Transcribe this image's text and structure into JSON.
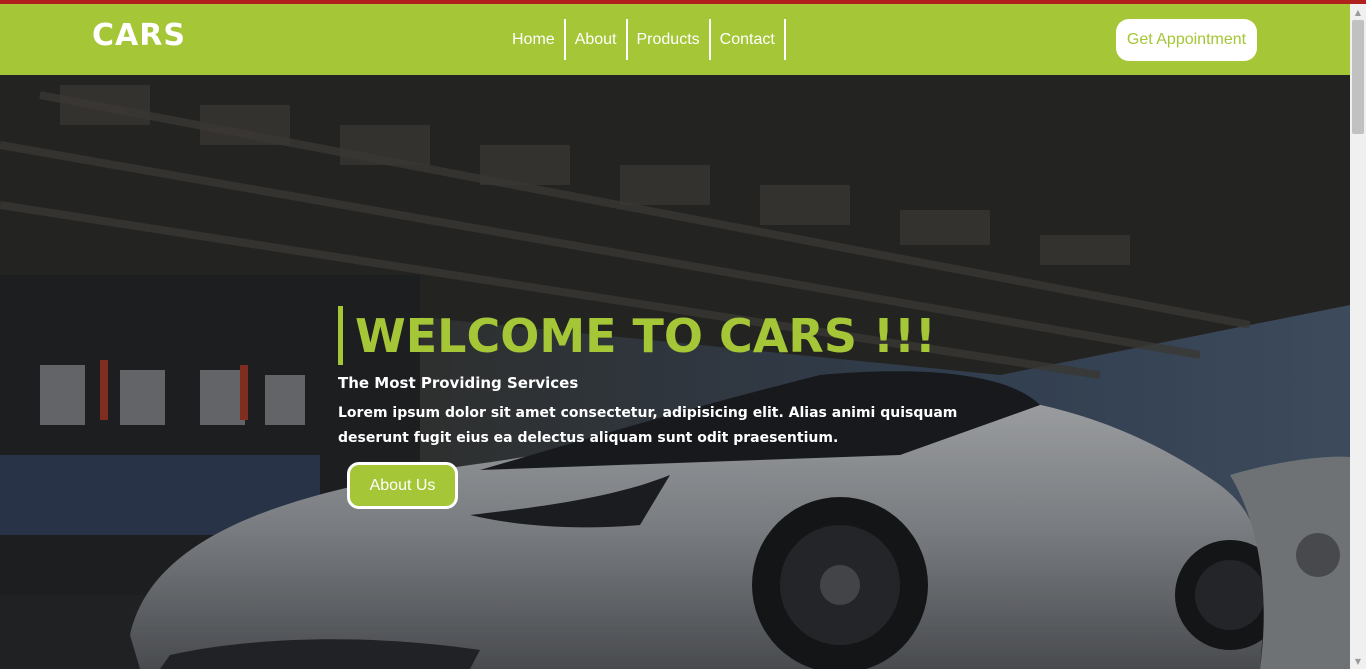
{
  "brand": {
    "name": "CARS"
  },
  "nav": {
    "items": [
      {
        "label": "Home"
      },
      {
        "label": "About"
      },
      {
        "label": "Products"
      },
      {
        "label": "Contact"
      }
    ],
    "cta_label": "Get Appointment"
  },
  "hero": {
    "title": "WELCOME TO CARS !!!",
    "subtitle": "The Most Providing Services",
    "body": "Lorem ipsum dolor sit amet consectetur, adipisicing elit. Alias animi quisquam deserunt fugit eius ea delectus aliquam sunt odit praesentium.",
    "button_label": "About Us",
    "background_image": "sports-car-at-racetrack-grandstand"
  },
  "colors": {
    "accent": "#a5c637",
    "top_strip": "#b0201c",
    "text_light": "#ffffff"
  },
  "icons": {
    "scroll_up": "chevron-up-icon",
    "scroll_down": "chevron-down-icon"
  }
}
